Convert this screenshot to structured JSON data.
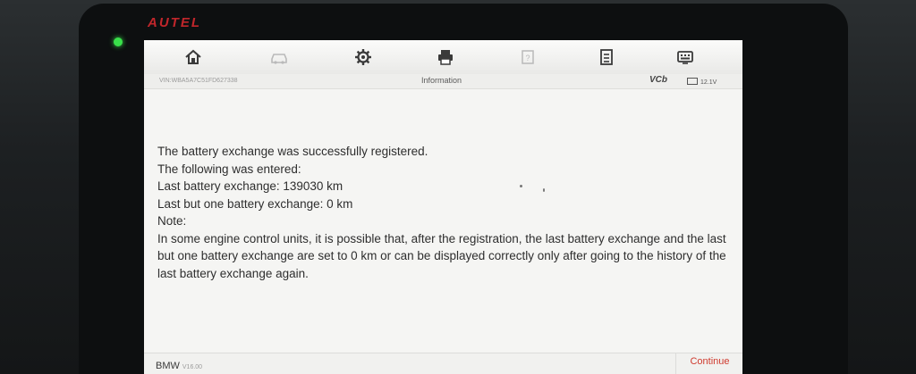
{
  "device": {
    "brand": "AUTEL",
    "led_color": "#39e04a"
  },
  "toolbar": {
    "icons": [
      {
        "name": "home-icon"
      },
      {
        "name": "vehicle-swap-icon"
      },
      {
        "name": "settings-icon"
      },
      {
        "name": "print-icon"
      },
      {
        "name": "help-icon"
      },
      {
        "name": "save-icon"
      },
      {
        "name": "data-logging-icon"
      }
    ]
  },
  "status_bar": {
    "vin": "VIN:WBA5A7C51FD627338",
    "title": "Information",
    "vci": "VCb",
    "voltage": "12.1V"
  },
  "message": {
    "line1": "The battery exchange was successfully registered.",
    "line2": "The following was entered:",
    "line3": "Last battery exchange: 139030 km",
    "line4": "Last but one battery exchange: 0 km",
    "note_label": "Note:",
    "note_text": "In some engine control units, it is possible that, after the registration, the last battery exchange and the last but one battery exchange are set to 0 km or can be displayed correctly only after going to the history of the last battery exchange again."
  },
  "footer": {
    "vehicle": "BMW",
    "version": "V16.00",
    "continue_label": "Continue"
  },
  "colors": {
    "accent": "#cf3a2e",
    "brand": "#c0262b",
    "screen_bg": "#f5f5f3"
  }
}
